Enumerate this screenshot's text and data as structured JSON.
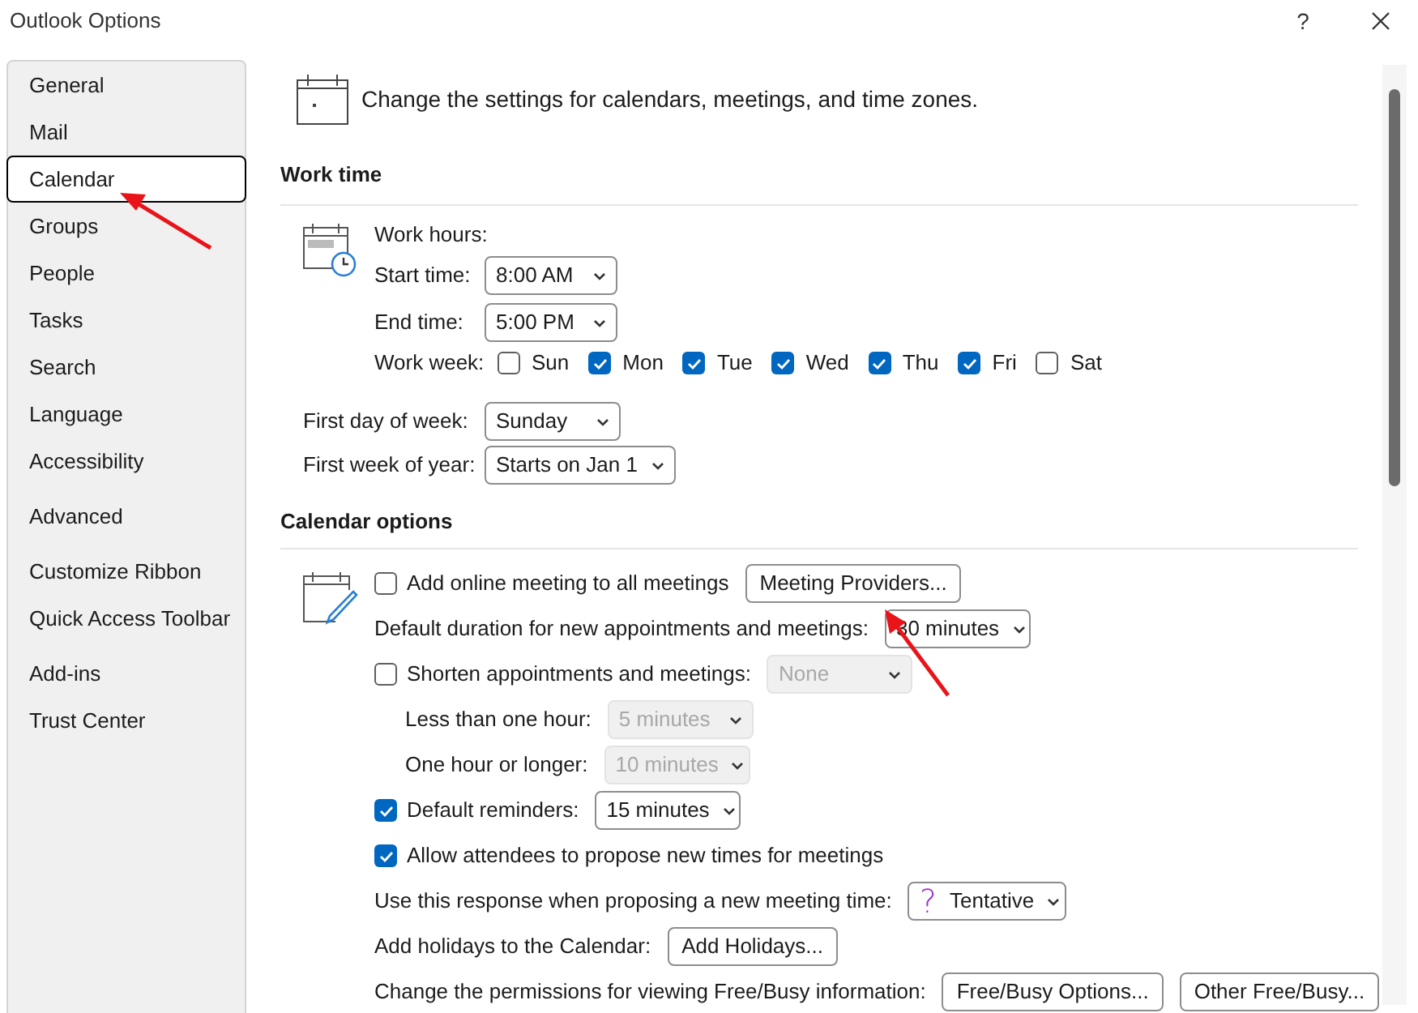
{
  "window": {
    "title": "Outlook Options",
    "help": "?"
  },
  "sidebar": {
    "groups": [
      {
        "items": [
          {
            "label": "General",
            "selected": false
          },
          {
            "label": "Mail",
            "selected": false
          },
          {
            "label": "Calendar",
            "selected": true
          },
          {
            "label": "Groups",
            "selected": false
          },
          {
            "label": "People",
            "selected": false
          },
          {
            "label": "Tasks",
            "selected": false
          },
          {
            "label": "Search",
            "selected": false
          },
          {
            "label": "Language",
            "selected": false
          },
          {
            "label": "Accessibility",
            "selected": false
          }
        ]
      },
      {
        "items": [
          {
            "label": "Advanced",
            "selected": false
          }
        ]
      },
      {
        "items": [
          {
            "label": "Customize Ribbon",
            "selected": false
          },
          {
            "label": "Quick Access Toolbar",
            "selected": false
          }
        ]
      },
      {
        "items": [
          {
            "label": "Add-ins",
            "selected": false
          },
          {
            "label": "Trust Center",
            "selected": false
          }
        ]
      }
    ]
  },
  "header": "Change the settings for calendars, meetings, and time zones.",
  "work_time": {
    "title": "Work time",
    "work_hours_label": "Work hours:",
    "start_time": {
      "label": "Start time:",
      "value": "8:00 AM"
    },
    "end_time": {
      "label": "End time:",
      "value": "5:00 PM"
    },
    "work_week": {
      "label": "Work week:",
      "days": [
        {
          "label": "Sun",
          "checked": false
        },
        {
          "label": "Mon",
          "checked": true
        },
        {
          "label": "Tue",
          "checked": true
        },
        {
          "label": "Wed",
          "checked": true
        },
        {
          "label": "Thu",
          "checked": true
        },
        {
          "label": "Fri",
          "checked": true
        },
        {
          "label": "Sat",
          "checked": false
        }
      ]
    },
    "first_day": {
      "label": "First day of week:",
      "value": "Sunday"
    },
    "first_week": {
      "label": "First week of year:",
      "value": "Starts on Jan 1"
    }
  },
  "calendar_options": {
    "title": "Calendar options",
    "rows": [
      {
        "kind": "check",
        "label": "Add online meeting to all meetings",
        "checked": false,
        "buttons": [
          "Meeting Providers..."
        ]
      },
      {
        "kind": "select",
        "label": "Default duration for new appointments and meetings:",
        "value": "30 minutes",
        "disabled": false
      },
      {
        "kind": "check_select",
        "label": "Shorten appointments and meetings:",
        "checked": false,
        "value": "None",
        "disabled": true
      },
      {
        "kind": "sub_select",
        "label": "Less than one hour:",
        "value": "5 minutes",
        "disabled": true
      },
      {
        "kind": "sub_select",
        "label": "One hour or longer:",
        "value": "10 minutes",
        "disabled": true
      },
      {
        "kind": "check_select",
        "label": "Default reminders:",
        "checked": true,
        "value": "15 minutes",
        "disabled": false
      },
      {
        "kind": "check",
        "label": "Allow attendees to propose new times for meetings",
        "checked": true
      },
      {
        "kind": "select",
        "label": "Use this response when proposing a new meeting time:",
        "value": "Tentative",
        "icon": "?",
        "disabled": false
      },
      {
        "kind": "button",
        "label": "Add holidays to the Calendar:",
        "buttons": [
          "Add Holidays..."
        ]
      },
      {
        "kind": "button",
        "label": "Change the permissions for viewing Free/Busy information:",
        "buttons": [
          "Free/Busy Options...",
          "Other Free/Busy..."
        ]
      }
    ]
  }
}
